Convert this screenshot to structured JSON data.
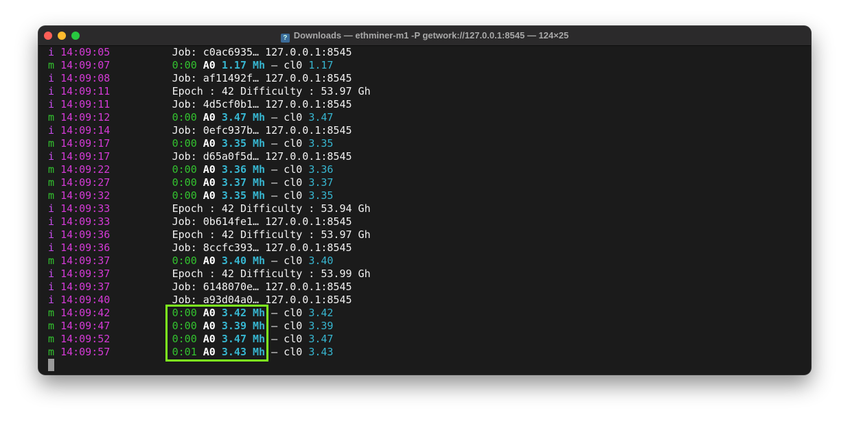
{
  "window": {
    "title": "Downloads — ethminer-m1 -P getwork://127.0.0.1:8545 — 124×25",
    "title_icon": "terminal-folder-icon"
  },
  "colors": {
    "highlight": "#7efb1e",
    "time": "#d43ad6",
    "rate": "#37b6d0",
    "elapsed": "#33c32f"
  },
  "log": [
    {
      "level": "i",
      "time": "14:09:05",
      "text": "Job: c0ac6935… 127.0.0.1:8545"
    },
    {
      "level": "m",
      "time": "14:09:07",
      "elapsed": "0:00",
      "gpu": "A0",
      "rate": "1.17 Mh",
      "sep": " – cl0 ",
      "dev_rate": "1.17"
    },
    {
      "level": "i",
      "time": "14:09:08",
      "text": "Job: af11492f… 127.0.0.1:8545"
    },
    {
      "level": "i",
      "time": "14:09:11",
      "text": "Epoch : 42 Difficulty : 53.97 Gh"
    },
    {
      "level": "i",
      "time": "14:09:11",
      "text": "Job: 4d5cf0b1… 127.0.0.1:8545"
    },
    {
      "level": "m",
      "time": "14:09:12",
      "elapsed": "0:00",
      "gpu": "A0",
      "rate": "3.47 Mh",
      "sep": " – cl0 ",
      "dev_rate": "3.47"
    },
    {
      "level": "i",
      "time": "14:09:14",
      "text": "Job: 0efc937b… 127.0.0.1:8545"
    },
    {
      "level": "m",
      "time": "14:09:17",
      "elapsed": "0:00",
      "gpu": "A0",
      "rate": "3.35 Mh",
      "sep": " – cl0 ",
      "dev_rate": "3.35"
    },
    {
      "level": "i",
      "time": "14:09:17",
      "text": "Job: d65a0f5d… 127.0.0.1:8545"
    },
    {
      "level": "m",
      "time": "14:09:22",
      "elapsed": "0:00",
      "gpu": "A0",
      "rate": "3.36 Mh",
      "sep": " – cl0 ",
      "dev_rate": "3.36"
    },
    {
      "level": "m",
      "time": "14:09:27",
      "elapsed": "0:00",
      "gpu": "A0",
      "rate": "3.37 Mh",
      "sep": " – cl0 ",
      "dev_rate": "3.37"
    },
    {
      "level": "m",
      "time": "14:09:32",
      "elapsed": "0:00",
      "gpu": "A0",
      "rate": "3.35 Mh",
      "sep": " – cl0 ",
      "dev_rate": "3.35"
    },
    {
      "level": "i",
      "time": "14:09:33",
      "text": "Epoch : 42 Difficulty : 53.94 Gh"
    },
    {
      "level": "i",
      "time": "14:09:33",
      "text": "Job: 0b614fe1… 127.0.0.1:8545"
    },
    {
      "level": "i",
      "time": "14:09:36",
      "text": "Epoch : 42 Difficulty : 53.97 Gh"
    },
    {
      "level": "i",
      "time": "14:09:36",
      "text": "Job: 8ccfc393… 127.0.0.1:8545"
    },
    {
      "level": "m",
      "time": "14:09:37",
      "elapsed": "0:00",
      "gpu": "A0",
      "rate": "3.40 Mh",
      "sep": " – cl0 ",
      "dev_rate": "3.40"
    },
    {
      "level": "i",
      "time": "14:09:37",
      "text": "Epoch : 42 Difficulty : 53.99 Gh"
    },
    {
      "level": "i",
      "time": "14:09:37",
      "text": "Job: 6148070e… 127.0.0.1:8545"
    },
    {
      "level": "i",
      "time": "14:09:40",
      "text": "Job: a93d04a0… 127.0.0.1:8545"
    },
    {
      "level": "m",
      "time": "14:09:42",
      "elapsed": "0:00",
      "gpu": "A0",
      "rate": "3.42 Mh",
      "sep": " – cl0 ",
      "dev_rate": "3.42"
    },
    {
      "level": "m",
      "time": "14:09:47",
      "elapsed": "0:00",
      "gpu": "A0",
      "rate": "3.39 Mh",
      "sep": " – cl0 ",
      "dev_rate": "3.39"
    },
    {
      "level": "m",
      "time": "14:09:52",
      "elapsed": "0:00",
      "gpu": "A0",
      "rate": "3.47 Mh",
      "sep": " – cl0 ",
      "dev_rate": "3.47"
    },
    {
      "level": "m",
      "time": "14:09:57",
      "elapsed": "0:01",
      "gpu": "A0",
      "rate": "3.43 Mh",
      "sep": " – cl0 ",
      "dev_rate": "3.43"
    }
  ]
}
